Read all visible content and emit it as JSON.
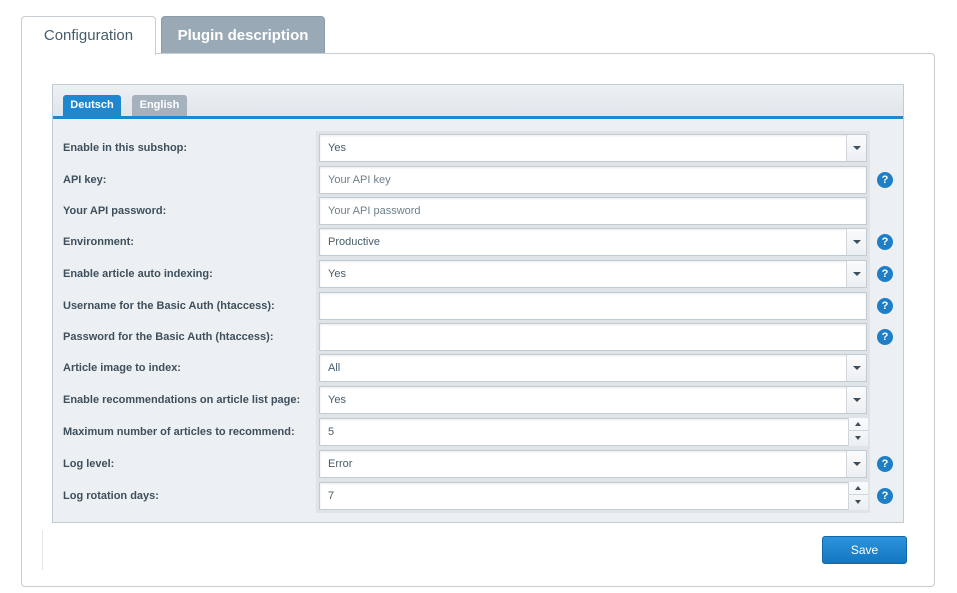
{
  "tabs": {
    "configuration": "Configuration",
    "plugin_description": "Plugin description"
  },
  "languages": {
    "deutsch": "Deutsch",
    "english": "English"
  },
  "form": {
    "subshop": {
      "label": "Enable in this subshop:",
      "value": "Yes"
    },
    "api_key": {
      "label": "API key:",
      "placeholder": "Your API key",
      "value": ""
    },
    "api_password": {
      "label": "Your API password:",
      "placeholder": "Your API password",
      "value": ""
    },
    "environment": {
      "label": "Environment:",
      "value": "Productive"
    },
    "auto_indexing": {
      "label": "Enable article auto indexing:",
      "value": "Yes"
    },
    "basic_auth_user": {
      "label": "Username for the Basic Auth (htaccess):",
      "value": ""
    },
    "basic_auth_password": {
      "label": "Password for the Basic Auth (htaccess):",
      "value": ""
    },
    "image_to_index": {
      "label": "Article image to index:",
      "value": "All"
    },
    "recommendations_list": {
      "label": "Enable recommendations on article list page:",
      "value": "Yes"
    },
    "max_articles": {
      "label": "Maximum number of articles to recommend:",
      "value": "5"
    },
    "log_level": {
      "label": "Log level:",
      "value": "Error"
    },
    "log_rotation": {
      "label": "Log rotation days:",
      "value": "7"
    }
  },
  "help_icon_glyph": "?",
  "footer": {
    "save_label": "Save"
  },
  "colors": {
    "accent": "#1e87d0",
    "inactive_tab": "#9aa9b6"
  }
}
